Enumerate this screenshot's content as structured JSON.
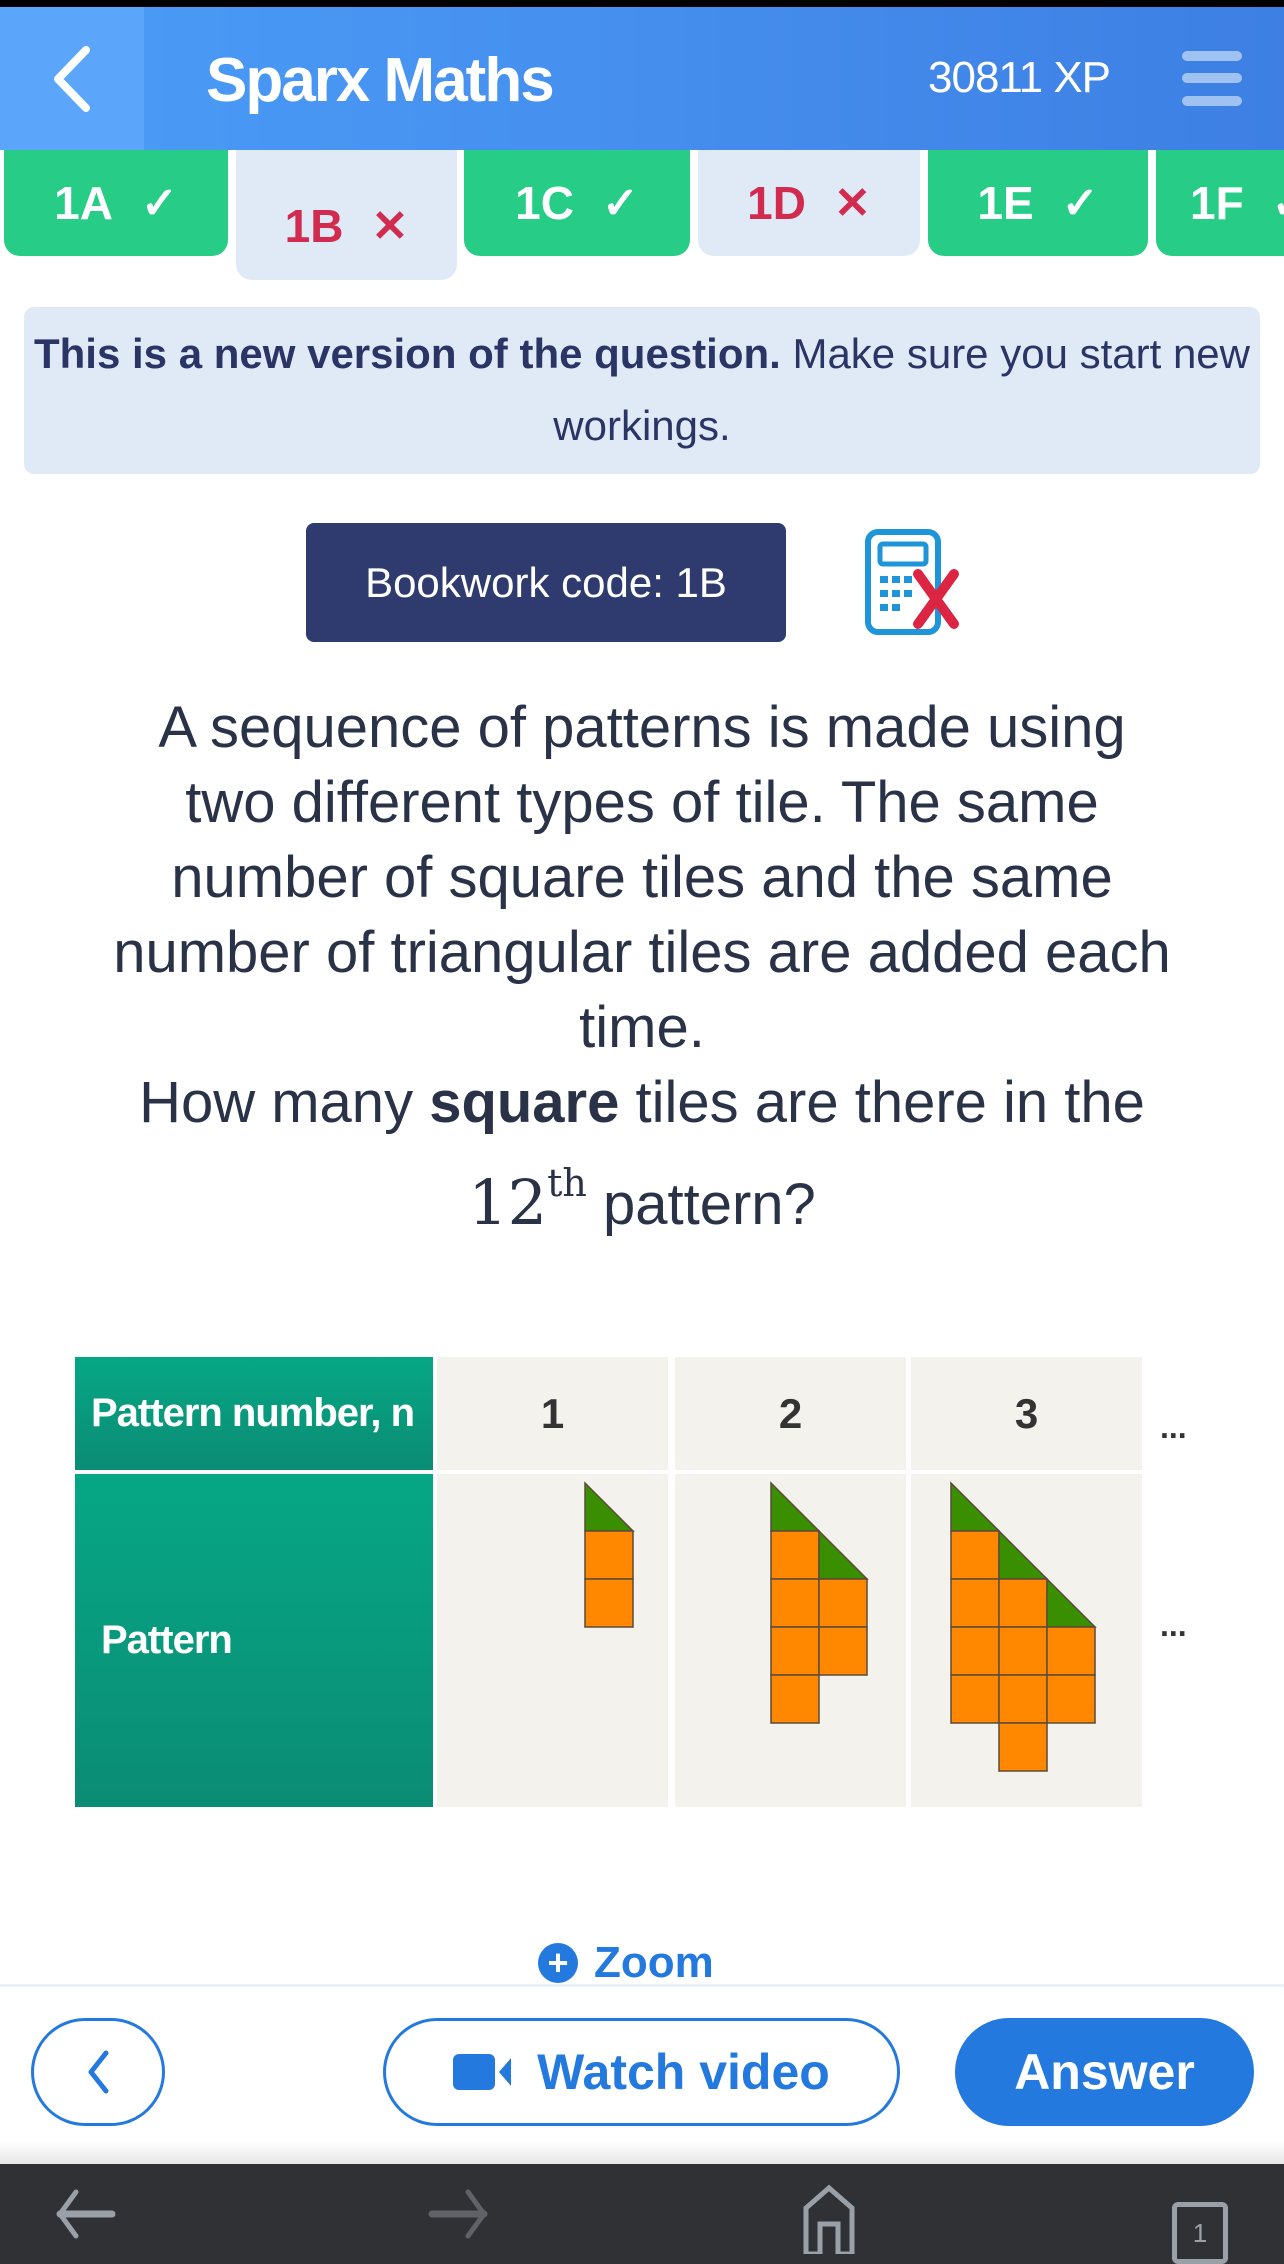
{
  "header": {
    "title": "Sparx Maths",
    "xp": "30811 XP",
    "back_icon": "chevron-left-icon",
    "menu_icon": "hamburger-menu-icon",
    "colors": {
      "header_start": "#4a9cf7",
      "header_end": "#3d7fe3",
      "back_panel": "#5ba6fb"
    }
  },
  "tabs": [
    {
      "label": "1A",
      "status": "correct",
      "mark": "✓"
    },
    {
      "label": "1B",
      "status": "incorrect",
      "mark": "✕",
      "active": true
    },
    {
      "label": "1C",
      "status": "correct",
      "mark": "✓"
    },
    {
      "label": "1D",
      "status": "incorrect",
      "mark": "✕"
    },
    {
      "label": "1E",
      "status": "correct",
      "mark": "✓"
    },
    {
      "label": "1F",
      "status": "correct",
      "mark": "✓"
    }
  ],
  "notice": {
    "bold": "This is a new version of the question.",
    "rest": " Make sure you start new workings."
  },
  "bookwork": {
    "label": "Bookwork code: 1B",
    "calculator_icon": "calculator-not-allowed-icon"
  },
  "question": {
    "lines": [
      "A sequence of patterns is made using",
      "two different types of tile. The same",
      "number of square tiles and the same",
      "number of triangular tiles are added each",
      "time."
    ],
    "ask_pre": "How many ",
    "ask_bold": "square",
    "ask_post": " tiles are there in the",
    "ordinal_number": "12",
    "ordinal_suffix": "th",
    "ask_end": " pattern?"
  },
  "pattern_table": {
    "row_header_1": "Pattern number, n",
    "row_header_2": "Pattern",
    "columns": [
      "1",
      "2",
      "3"
    ],
    "ellipsis": "...",
    "patterns": [
      {
        "n": 1,
        "columns": [
          {
            "triangle_row": 0,
            "square_rows": [
              1,
              2
            ]
          }
        ]
      },
      {
        "n": 2,
        "columns": [
          {
            "triangle_row": 0,
            "square_rows": [
              1,
              2,
              3,
              4
            ]
          },
          {
            "triangle_row": 1,
            "square_rows": [
              2,
              3
            ]
          }
        ]
      },
      {
        "n": 3,
        "columns": [
          {
            "triangle_row": 0,
            "square_rows": [
              1,
              2,
              3,
              4
            ]
          },
          {
            "triangle_row": 1,
            "square_rows": [
              2,
              3,
              4,
              5
            ]
          },
          {
            "triangle_row": 2,
            "square_rows": [
              3,
              4
            ]
          }
        ]
      }
    ],
    "colors": {
      "square": "#ff8800",
      "triangle": "#3a8f00",
      "outline": "#5a4a3a"
    }
  },
  "actions": {
    "zoom_label": "Zoom",
    "watch_video_label": "Watch video",
    "answer_label": "Answer",
    "accent": "#2479de"
  },
  "navbar": {
    "page_count": "1"
  }
}
